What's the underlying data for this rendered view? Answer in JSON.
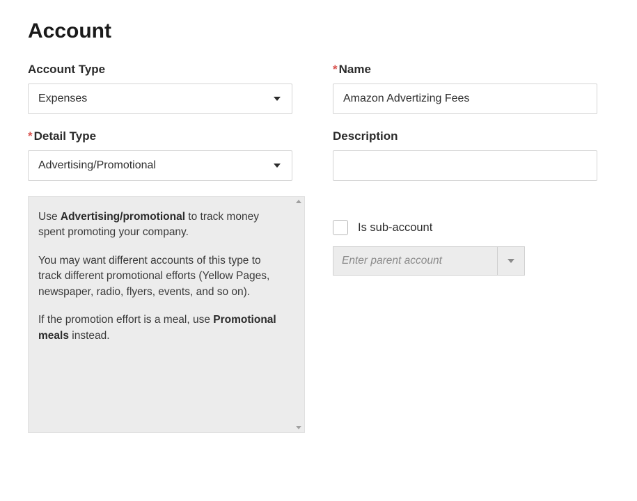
{
  "page_title": "Account",
  "left": {
    "account_type_label": "Account Type",
    "account_type_value": "Expenses",
    "detail_type_label": "Detail Type",
    "detail_type_value": "Advertising/Promotional",
    "help": {
      "p1_pre": "Use ",
      "p1_bold": "Advertising/promotional",
      "p1_post": " to track money spent promoting your company.",
      "p2": "You may want different accounts of this type to track different promotional efforts (Yellow Pages, newspaper, radio, flyers, events, and so on).",
      "p3_pre": "If the promotion effort is a meal, use ",
      "p3_bold": "Promotional meals",
      "p3_post": " instead."
    }
  },
  "right": {
    "name_label": "Name",
    "name_value": "Amazon Advertizing Fees",
    "description_label": "Description",
    "description_value": "",
    "sub_account_label": "Is sub-account",
    "parent_account_placeholder": "Enter parent account"
  }
}
